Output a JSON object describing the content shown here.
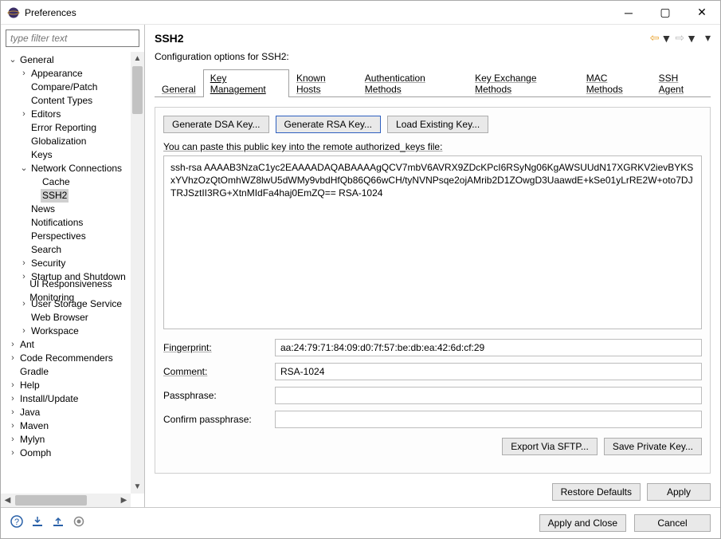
{
  "window": {
    "title": "Preferences"
  },
  "sidebar": {
    "filter_placeholder": "type filter text",
    "items": [
      {
        "label": "General",
        "depth": 0,
        "twisty": "open",
        "sel": false
      },
      {
        "label": "Appearance",
        "depth": 1,
        "twisty": "closed",
        "sel": false
      },
      {
        "label": "Compare/Patch",
        "depth": 1,
        "twisty": "none",
        "sel": false
      },
      {
        "label": "Content Types",
        "depth": 1,
        "twisty": "none",
        "sel": false
      },
      {
        "label": "Editors",
        "depth": 1,
        "twisty": "closed",
        "sel": false
      },
      {
        "label": "Error Reporting",
        "depth": 1,
        "twisty": "none",
        "sel": false
      },
      {
        "label": "Globalization",
        "depth": 1,
        "twisty": "none",
        "sel": false
      },
      {
        "label": "Keys",
        "depth": 1,
        "twisty": "none",
        "sel": false
      },
      {
        "label": "Network Connections",
        "depth": 1,
        "twisty": "open",
        "sel": false
      },
      {
        "label": "Cache",
        "depth": 2,
        "twisty": "none",
        "sel": false
      },
      {
        "label": "SSH2",
        "depth": 2,
        "twisty": "none",
        "sel": true
      },
      {
        "label": "News",
        "depth": 1,
        "twisty": "none",
        "sel": false
      },
      {
        "label": "Notifications",
        "depth": 1,
        "twisty": "none",
        "sel": false
      },
      {
        "label": "Perspectives",
        "depth": 1,
        "twisty": "none",
        "sel": false
      },
      {
        "label": "Search",
        "depth": 1,
        "twisty": "none",
        "sel": false
      },
      {
        "label": "Security",
        "depth": 1,
        "twisty": "closed",
        "sel": false
      },
      {
        "label": "Startup and Shutdown",
        "depth": 1,
        "twisty": "closed",
        "sel": false
      },
      {
        "label": "UI Responsiveness Monitoring",
        "depth": 1,
        "twisty": "none",
        "sel": false
      },
      {
        "label": "User Storage Service",
        "depth": 1,
        "twisty": "closed",
        "sel": false
      },
      {
        "label": "Web Browser",
        "depth": 1,
        "twisty": "none",
        "sel": false
      },
      {
        "label": "Workspace",
        "depth": 1,
        "twisty": "closed",
        "sel": false
      },
      {
        "label": "Ant",
        "depth": 0,
        "twisty": "closed",
        "sel": false
      },
      {
        "label": "Code Recommenders",
        "depth": 0,
        "twisty": "closed",
        "sel": false
      },
      {
        "label": "Gradle",
        "depth": 0,
        "twisty": "none",
        "sel": false
      },
      {
        "label": "Help",
        "depth": 0,
        "twisty": "closed",
        "sel": false
      },
      {
        "label": "Install/Update",
        "depth": 0,
        "twisty": "closed",
        "sel": false
      },
      {
        "label": "Java",
        "depth": 0,
        "twisty": "closed",
        "sel": false
      },
      {
        "label": "Maven",
        "depth": 0,
        "twisty": "closed",
        "sel": false
      },
      {
        "label": "Mylyn",
        "depth": 0,
        "twisty": "closed",
        "sel": false
      },
      {
        "label": "Oomph",
        "depth": 0,
        "twisty": "closed",
        "sel": false
      }
    ]
  },
  "page": {
    "title": "SSH2",
    "subtitle": "Configuration options for SSH2:",
    "tabs": [
      "General",
      "Key Management",
      "Known Hosts",
      "Authentication Methods",
      "Key Exchange Methods",
      "MAC Methods",
      "SSH Agent"
    ],
    "active_tab": 1,
    "buttons": {
      "gen_dsa": "Generate DSA Key...",
      "gen_rsa": "Generate RSA Key...",
      "load_key": "Load Existing Key..."
    },
    "hint": "You can paste this public key into the remote authorized_keys file:",
    "public_key": "ssh-rsa AAAAB3NzaC1yc2EAAAADAQABAAAAgQCV7mbV6AVRX9ZDcKPcI6RSyNg06KgAWSUUdN17XGRKV2ievBYKSxYVhzOzQtOmhWZ8lwU5dWMy9vbdHfQb86Q66wCH/tyNVNPsqe2ojAMrib2D1ZOwgD3UaawdE+kSe01yLrRE2W+oto7DJTRJSztII3RG+XtnMIdFa4haj0EmZQ== RSA-1024",
    "fields": {
      "fingerprint_label": "Fingerprint:",
      "fingerprint_value": "aa:24:79:71:84:09:d0:7f:57:be:db:ea:42:6d:cf:29",
      "comment_label": "Comment:",
      "comment_value": "RSA-1024",
      "passphrase_label": "Passphrase:",
      "passphrase_value": "",
      "confirm_label": "Confirm passphrase:",
      "confirm_value": ""
    },
    "panel_buttons": {
      "export_sftp": "Export Via SFTP...",
      "save_private": "Save Private Key..."
    },
    "bottom_buttons": {
      "restore": "Restore Defaults",
      "apply": "Apply"
    }
  },
  "footer": {
    "apply_close": "Apply and Close",
    "cancel": "Cancel"
  }
}
